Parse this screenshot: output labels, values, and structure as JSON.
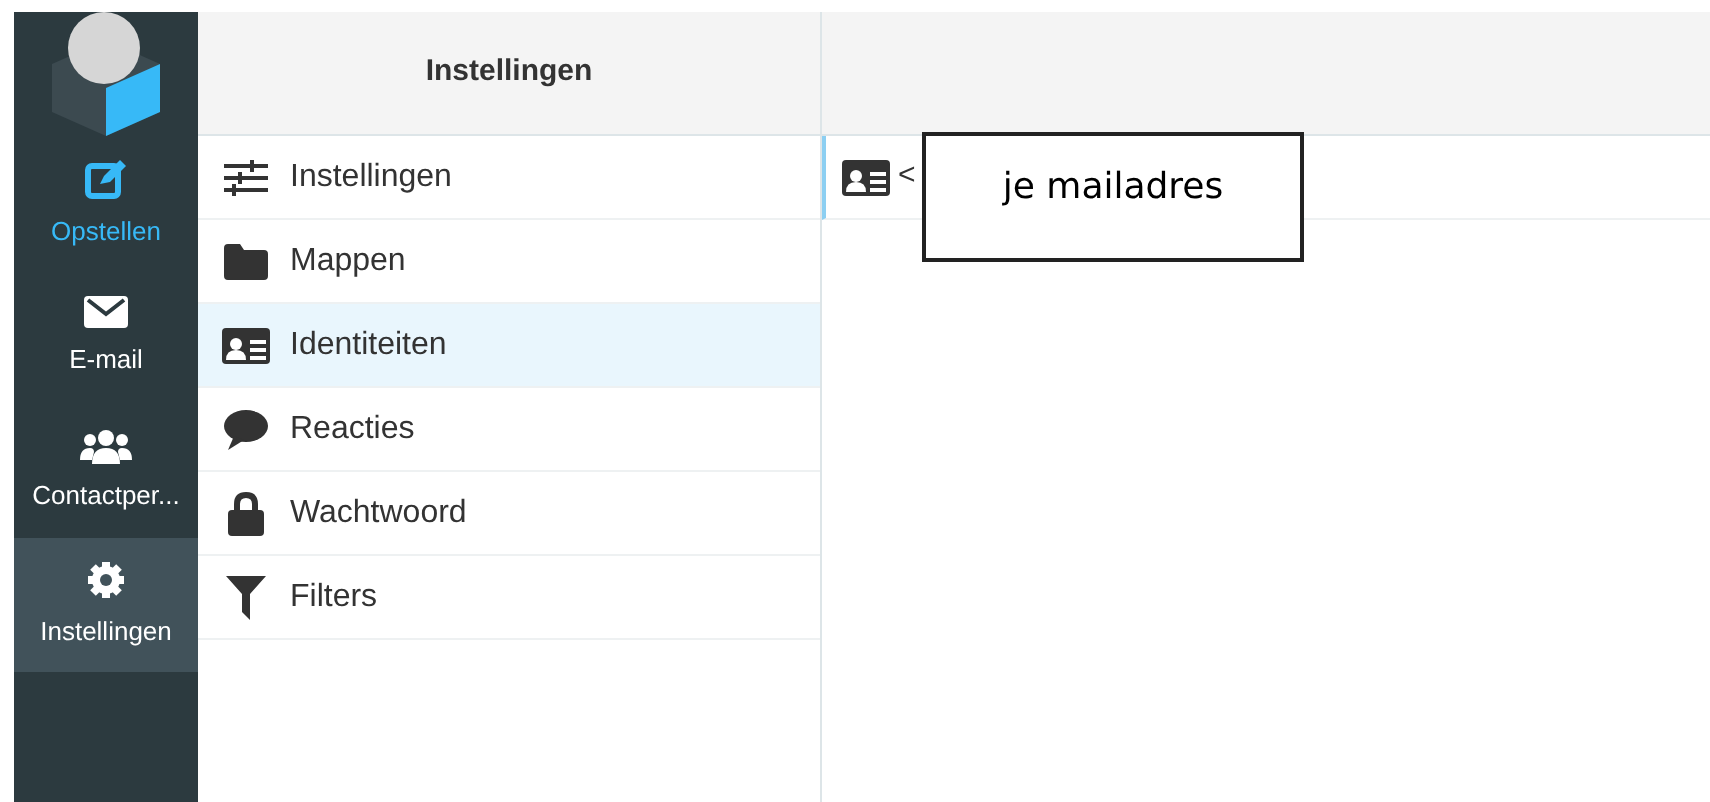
{
  "nav": [
    {
      "label": "Opstellen",
      "kind": "compose",
      "selected": false,
      "accent": true
    },
    {
      "label": "E-mail",
      "kind": "mail",
      "selected": false,
      "accent": false
    },
    {
      "label": "Contactper...",
      "kind": "contacts",
      "selected": false,
      "accent": false
    },
    {
      "label": "Instellingen",
      "kind": "settings",
      "selected": true,
      "accent": false
    }
  ],
  "panel": {
    "title": "Instellingen",
    "items": [
      {
        "label": "Instellingen",
        "kind": "sliders",
        "selected": false
      },
      {
        "label": "Mappen",
        "kind": "folder",
        "selected": false
      },
      {
        "label": "Identiteiten",
        "kind": "idcard",
        "selected": true
      },
      {
        "label": "Reacties",
        "kind": "comment",
        "selected": false
      },
      {
        "label": "Wachtwoord",
        "kind": "lock",
        "selected": false
      },
      {
        "label": "Filters",
        "kind": "filter",
        "selected": false
      }
    ]
  },
  "identities": [
    {
      "text": "<"
    }
  ],
  "callout": {
    "text": "je mailadres"
  }
}
